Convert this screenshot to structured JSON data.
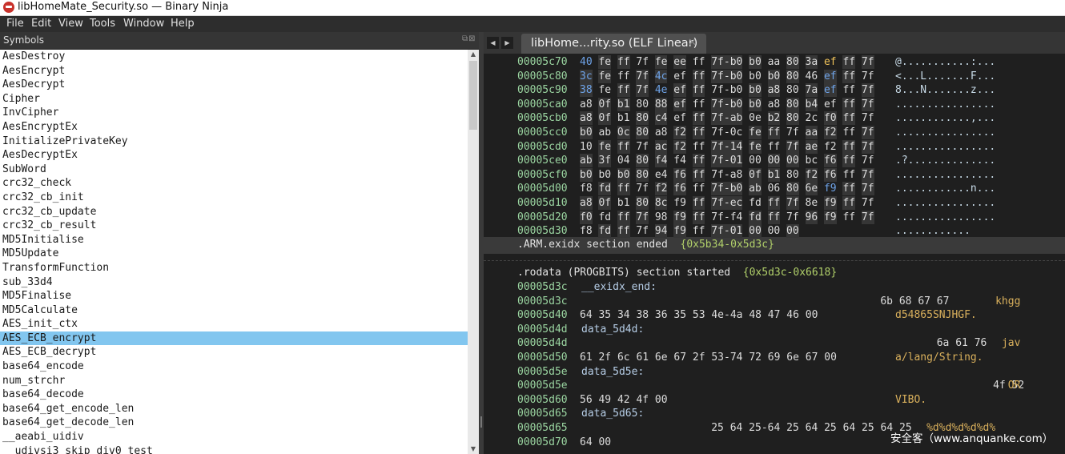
{
  "window": {
    "title": "libHomeMate_Security.so — Binary Ninja"
  },
  "menu": [
    "File",
    "Edit",
    "View",
    "Tools",
    "Window",
    "Help"
  ],
  "symbols": {
    "title": "Symbols",
    "dock_icons": "⧉⊠",
    "items": [
      "AesDestroy",
      "AesEncrypt",
      "AesDecrypt",
      "Cipher",
      "InvCipher",
      "AesEncryptEx",
      "InitializePrivateKey",
      "AesDecryptEx",
      "SubWord",
      "crc32_check",
      "crc32_cb_init",
      "crc32_cb_update",
      "crc32_cb_result",
      "MD5Initialise",
      "MD5Update",
      "TransformFunction",
      "sub_33d4",
      "MD5Finalise",
      "MD5Calculate",
      "AES_init_ctx",
      "AES_ECB_encrypt",
      "AES_ECB_decrypt",
      "base64_encode",
      "num_strchr",
      "base64_decode",
      "base64_get_encode_len",
      "base64_get_decode_len",
      "__aeabi_uidiv",
      "__udivsi3_skip_div0_test"
    ],
    "selected_index": 20
  },
  "tabbar": {
    "back_icon": "◀",
    "forward_icon": "▶",
    "tab_label": "libHome...rity.so (ELF Linear)",
    "close_icon": "✕"
  },
  "hex_rows": [
    {
      "addr": "00005c70",
      "bytes": [
        "40",
        "fe",
        "ff",
        "7f",
        "fe",
        "ee",
        "ff",
        "7f-b0",
        "b0",
        "aa",
        "80",
        "3a",
        "ef",
        "ff",
        "7f"
      ],
      "ascii": "@...........:..."
    },
    {
      "addr": "00005c80",
      "bytes": [
        "3c",
        "fe",
        "ff",
        "7f",
        "4c",
        "ef",
        "ff",
        "7f-b0",
        "b0",
        "b0",
        "80",
        "46",
        "ef",
        "ff",
        "7f"
      ],
      "ascii": "<...L.......F..."
    },
    {
      "addr": "00005c90",
      "bytes": [
        "38",
        "fe",
        "ff",
        "7f",
        "4e",
        "ef",
        "ff",
        "7f-b0",
        "b0",
        "a8",
        "80",
        "7a",
        "ef",
        "ff",
        "7f"
      ],
      "ascii": "8...N.......z..."
    },
    {
      "addr": "00005ca0",
      "bytes": [
        "a8",
        "0f",
        "b1",
        "80",
        "88",
        "ef",
        "ff",
        "7f-b0",
        "b0",
        "a8",
        "80",
        "b4",
        "ef",
        "ff",
        "7f"
      ],
      "ascii": "................"
    },
    {
      "addr": "00005cb0",
      "bytes": [
        "a8",
        "0f",
        "b1",
        "80",
        "c4",
        "ef",
        "ff",
        "7f-ab",
        "0e",
        "b2",
        "80",
        "2c",
        "f0",
        "ff",
        "7f"
      ],
      "ascii": "............,..."
    },
    {
      "addr": "00005cc0",
      "bytes": [
        "b0",
        "ab",
        "0c",
        "80",
        "a8",
        "f2",
        "ff",
        "7f-0c",
        "fe",
        "ff",
        "7f",
        "aa",
        "f2",
        "ff",
        "7f"
      ],
      "ascii": "................"
    },
    {
      "addr": "00005cd0",
      "bytes": [
        "10",
        "fe",
        "ff",
        "7f",
        "ac",
        "f2",
        "ff",
        "7f-14",
        "fe",
        "ff",
        "7f",
        "ae",
        "f2",
        "ff",
        "7f"
      ],
      "ascii": "................"
    },
    {
      "addr": "00005ce0",
      "bytes": [
        "ab",
        "3f",
        "04",
        "80",
        "f4",
        "f4",
        "ff",
        "7f-01",
        "00",
        "00",
        "00",
        "bc",
        "f6",
        "ff",
        "7f"
      ],
      "ascii": ".?.............."
    },
    {
      "addr": "00005cf0",
      "bytes": [
        "b0",
        "b0",
        "b0",
        "80",
        "e4",
        "f6",
        "ff",
        "7f-a8",
        "0f",
        "b1",
        "80",
        "f2",
        "f6",
        "ff",
        "7f"
      ],
      "ascii": "................"
    },
    {
      "addr": "00005d00",
      "bytes": [
        "f8",
        "fd",
        "ff",
        "7f",
        "f2",
        "f6",
        "ff",
        "7f-b0",
        "ab",
        "06",
        "80",
        "6e",
        "f9",
        "ff",
        "7f"
      ],
      "ascii": "............n..."
    },
    {
      "addr": "00005d10",
      "bytes": [
        "a8",
        "0f",
        "b1",
        "80",
        "8c",
        "f9",
        "ff",
        "7f-ec",
        "fd",
        "ff",
        "7f",
        "8e",
        "f9",
        "ff",
        "7f"
      ],
      "ascii": "................"
    },
    {
      "addr": "00005d20",
      "bytes": [
        "f0",
        "fd",
        "ff",
        "7f",
        "98",
        "f9",
        "ff",
        "7f-f4",
        "fd",
        "ff",
        "7f",
        "96",
        "f9",
        "ff",
        "7f"
      ],
      "ascii": "................"
    },
    {
      "addr": "00005d30",
      "bytes": [
        "f8",
        "fd",
        "ff",
        "7f",
        "94",
        "f9",
        "ff",
        "7f-01",
        "00",
        "00",
        "00"
      ],
      "ascii": "............"
    }
  ],
  "section_end": {
    "text": ".ARM.exidx section ended",
    "range": "{0x5b34-0x5d3c}"
  },
  "section_start": {
    "text": ".rodata (PROGBITS) section started",
    "range": "{0x5d3c-0x6618}"
  },
  "rodata_lines": [
    {
      "addr": "00005d3c",
      "label": "__exidx_end:"
    },
    {
      "addr": "00005d3c",
      "bytes": "6b 68 67 67",
      "bytes_col": 16,
      "str": "khgg",
      "str_col": 52
    },
    {
      "addr": "00005d40",
      "bytes": "64 35 34 38 36 35 53 4e-4a 48 47 46 00",
      "bytes_col": 0,
      "str": "d54865SNJHGF.",
      "str_col": 36
    },
    {
      "addr": "00005d4d",
      "label": "data_5d4d:"
    },
    {
      "addr": "00005d4d",
      "bytes": "6a 61 76",
      "bytes_col": 19,
      "str": "jav",
      "str_col": 53
    },
    {
      "addr": "00005d50",
      "bytes": "61 2f 6c 61 6e 67 2f 53-74 72 69 6e 67 00",
      "bytes_col": 0,
      "str": "a/lang/String.",
      "str_col": 36
    },
    {
      "addr": "00005d5e",
      "label": "data_5d5e:"
    },
    {
      "addr": "00005d5e",
      "bytes": "4f 52",
      "bytes_col": 22,
      "str": "OR",
      "str_col": 54
    },
    {
      "addr": "00005d60",
      "bytes": "56 49 42 4f 00",
      "bytes_col": 0,
      "str": "VIBO.",
      "str_col": 36
    },
    {
      "addr": "00005d65",
      "label": "data_5d65:"
    },
    {
      "addr": "00005d65",
      "bytes": "25 64 25-64 25 64 25 64 25 64 25",
      "bytes_col": 7,
      "str": "%d%d%d%d%d%",
      "str_col": 41
    },
    {
      "addr": "00005d70",
      "bytes": "64 00",
      "bytes_col": 0,
      "str": "",
      "str_col": 36
    }
  ],
  "colors": {
    "selection": "#82c6ef",
    "address": "#9ad4a0",
    "section_range": "#b1d06a",
    "string": "#d9b05c",
    "label": "#b6cde6"
  },
  "watermark": "安全客（www.anquanke.com）"
}
